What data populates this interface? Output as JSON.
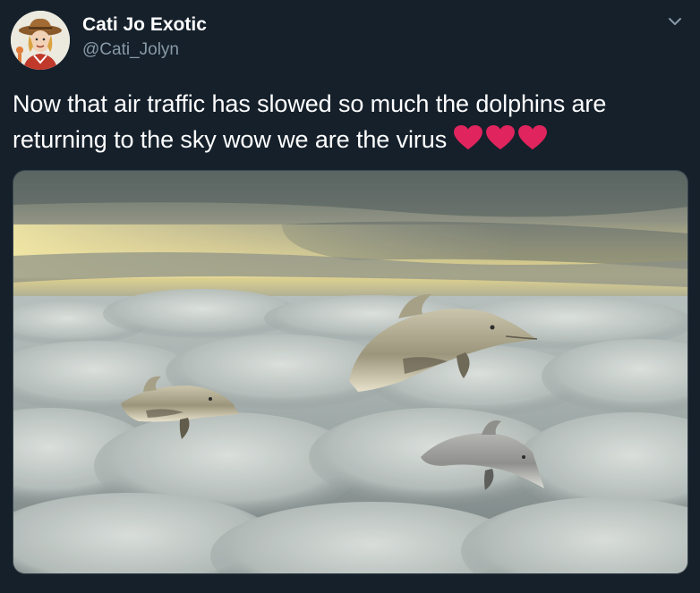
{
  "author": {
    "display_name": "Cati Jo Exotic",
    "handle": "@Cati_Jolyn"
  },
  "tweet": {
    "text": "Now that air traffic has slowed so much the dolphins are returning to the sky wow we are the virus",
    "emoji": [
      "red-heart",
      "red-heart",
      "red-heart"
    ]
  },
  "icons": {
    "menu": "chevron-down-icon",
    "heart": "heart-icon"
  },
  "colors": {
    "background": "#15202b",
    "text_primary": "#ffffff",
    "text_secondary": "#8899a6",
    "heart": "#e0245e"
  }
}
